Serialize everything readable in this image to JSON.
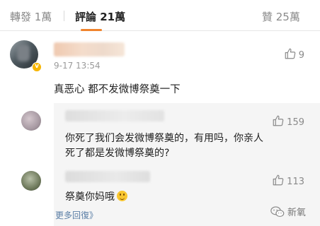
{
  "tabs": [
    {
      "label": "轉發 1萬"
    },
    {
      "label": "評論 21萬"
    },
    {
      "label": "贊 25萬"
    }
  ],
  "comment": {
    "time": "9-17 13:54",
    "text": "真恶心 都不发微博祭奠一下",
    "likes": "9"
  },
  "replies": [
    {
      "text_line1": "你死了我们会发微博祭奠的，有用吗，你亲人",
      "text_line2": "死了都是发微博祭奠的?",
      "likes": "159"
    },
    {
      "text": "祭奠你妈哦",
      "likes": "113"
    }
  ],
  "more_replies": "更多回復》",
  "watermark": "新氧",
  "colors": {
    "accent": "#f0842d",
    "link": "#5a7ea6",
    "reply_bg": "#f5f5f5"
  }
}
